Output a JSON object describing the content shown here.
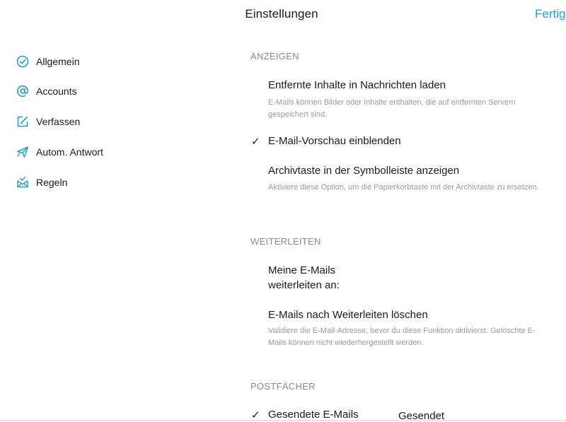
{
  "header": {
    "title": "Einstellungen",
    "done_label": "Fertig"
  },
  "sidebar": {
    "items": [
      {
        "label": "Allgemein",
        "icon": "check-circle-icon"
      },
      {
        "label": "Accounts",
        "icon": "at-sign-icon"
      },
      {
        "label": "Verfassen",
        "icon": "compose-icon"
      },
      {
        "label": "Autom. Antwort",
        "icon": "paper-plane-icon"
      },
      {
        "label": "Regeln",
        "icon": "inbox-rules-icon"
      }
    ]
  },
  "colors": {
    "accent": "#1fa0d8",
    "section_header": "#8a8a8a",
    "description": "#9a9a9a"
  },
  "sections": {
    "anzeigen": {
      "header": "ANZEIGEN",
      "remote_content": {
        "title": "Entfernte Inhalte in Nachrichten laden",
        "description": "E-Mails können Bilder oder Inhalte enthalten, die auf entfernten Servern gespeichert sind.",
        "checked": false
      },
      "preview": {
        "title": "E-Mail-Vorschau einblenden",
        "checked": true
      },
      "archive": {
        "title": "Archivtaste in der Symbolleiste anzeigen",
        "description": "Aktiviere diese Option, um die Papierkorbtaste mit der Archivtaste zu ersetzen.",
        "checked": false
      }
    },
    "weiterleiten": {
      "header": "WEITERLEITEN",
      "forward_to": {
        "line1": "Meine E-Mails",
        "line2": "weiterleiten an:"
      },
      "delete_after_forward": {
        "title": "E-Mails nach Weiterleiten löschen",
        "description": "Validiere die E-Mail-Adresse, bevor du diese Funktion aktivierst. Gelöschte E-Mails können nicht wiederhergestellt werden.",
        "checked": false
      }
    },
    "postfaecher": {
      "header": "POSTFÄCHER",
      "sent": {
        "title": "Gesendete E-Mails",
        "value": "Gesendet",
        "checked": true
      }
    }
  },
  "check_glyph": "✓"
}
